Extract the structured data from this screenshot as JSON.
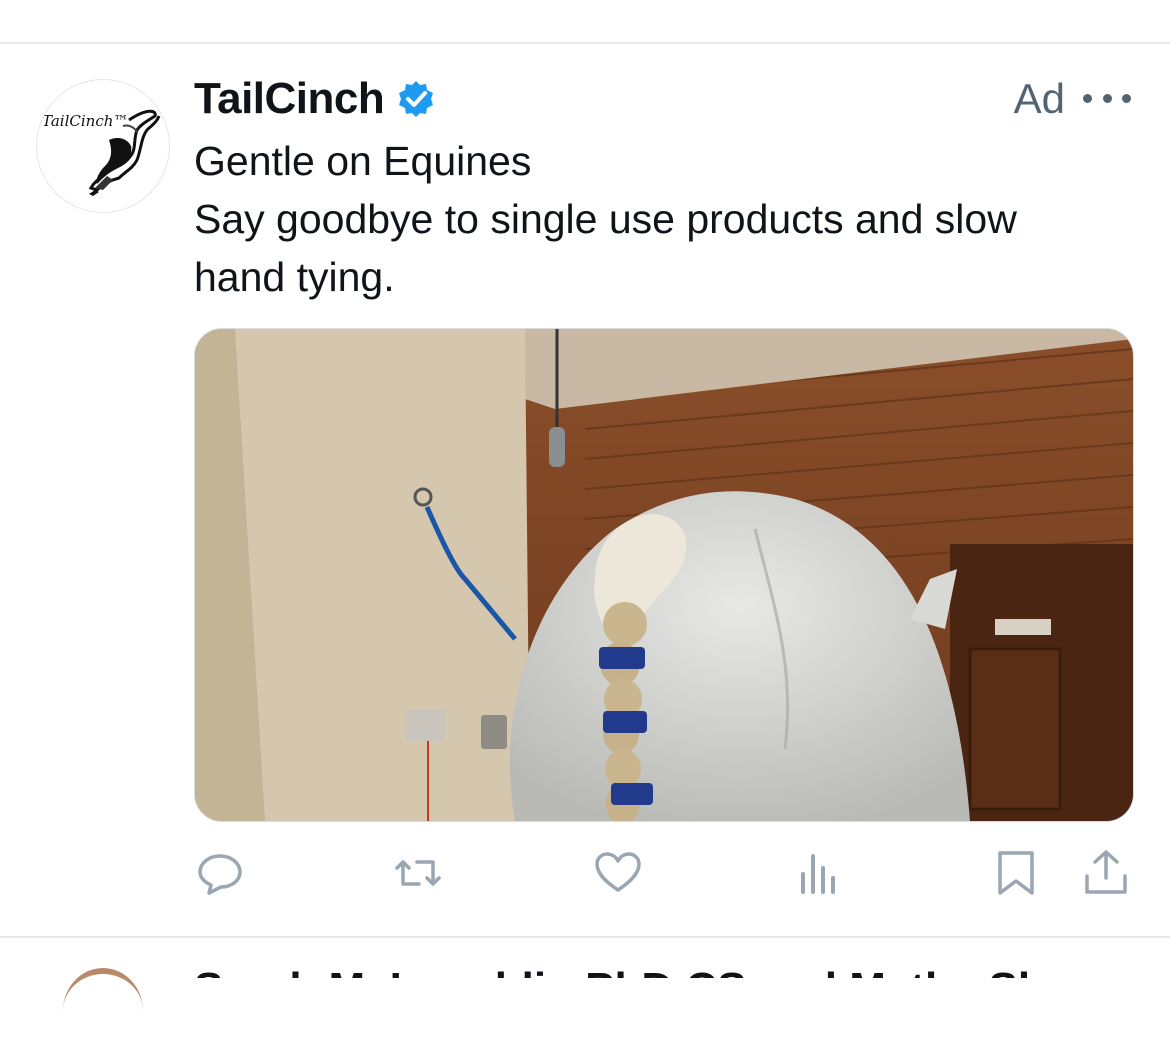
{
  "tweet": {
    "author": "TailCinch",
    "ad_label": "Ad",
    "avatar_text": "TailCinch™",
    "lines": [
      "Gentle on Equines",
      "Say goodbye to single use products and slow",
      "hand tying."
    ]
  },
  "icons": {
    "verified": "verified-badge-icon",
    "more": "more-options-icon",
    "reply": "reply-icon",
    "retweet": "retweet-icon",
    "like": "like-icon",
    "views": "views-icon",
    "bookmark": "bookmark-icon",
    "share": "share-icon"
  },
  "colors": {
    "verified": "#1d9bf0",
    "action_icon": "#9aa6b1",
    "secondary_text": "#536471",
    "divider": "#e6e9ec"
  },
  "next_tweet": {
    "author_partial": "Sarah McLaughlin PhD CS and Mathe Sh"
  }
}
